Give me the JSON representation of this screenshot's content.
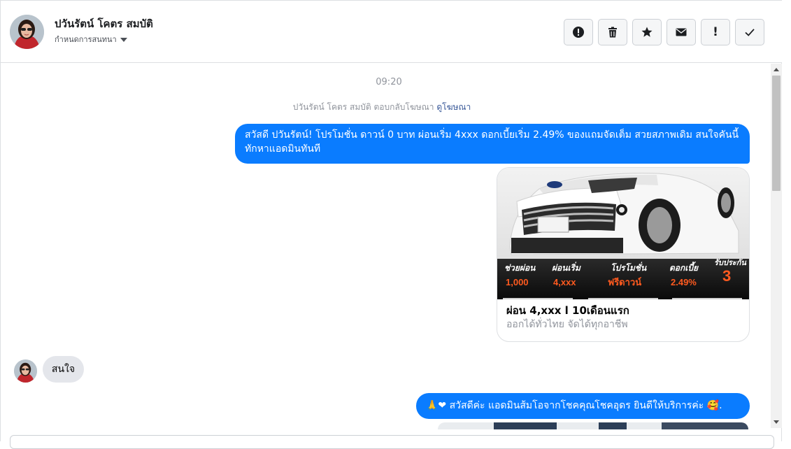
{
  "contact": {
    "name": "ปวันรัตน์ โคตร สมบัติ",
    "assign_label": "กำหนดการสนทนา"
  },
  "toolbar": {
    "buttons": [
      {
        "icon": "alert-circle-icon",
        "label": ""
      },
      {
        "icon": "trash-icon",
        "label": ""
      },
      {
        "icon": "star-icon",
        "label": ""
      },
      {
        "icon": "envelope-icon",
        "label": ""
      },
      {
        "icon": "exclamation-icon",
        "label": "!"
      },
      {
        "icon": "check-icon",
        "label": ""
      }
    ]
  },
  "thread": {
    "timestamp": "09:20",
    "ad_reply_text": "ปวันรัตน์ โคตร สมบัติ ตอบกลับโฆษณา",
    "ad_reply_link": "ดูโฆษณา",
    "messages": [
      {
        "direction": "outgoing",
        "text": "สวัสดี ปวันรัตน์! โปรโมชั่น ดาวน์ 0 บาท ผ่อนเริ่ม 4xxx ดอกเบี้ยเริ่ม 2.49% ของแถมจัดเต็ม สวยสภาพเดิม สนใจคันนี้ทักหาแอดมินทันที"
      },
      {
        "direction": "outgoing",
        "type": "card",
        "title": "ผ่อน 4,xxx l 10เดือนแรก",
        "subtitle": "ออกได้ทั่วไทย จัดได้ทุกอาชีพ",
        "banner": [
          {
            "label": "ช่วยผ่อน",
            "value": "1,000"
          },
          {
            "label": "ผ่อนเริ่ม",
            "value": "4,xxx"
          },
          {
            "label": "โปรโมชั่น",
            "value": "ฟรีดาวน์"
          },
          {
            "label": "ดอกเบี้ย",
            "value": "2.49%"
          },
          {
            "label": "รับประกัน",
            "value": "3"
          }
        ]
      },
      {
        "direction": "incoming",
        "text": "สนใจ"
      },
      {
        "direction": "outgoing",
        "text": "สวัสดีค่ะ แอดมินส้มโอจากโชคคุณโชคอุดร ยินดีให้บริการค่ะ",
        "prefix_emoji": "🙏❤",
        "suffix_emoji": "🥰."
      }
    ]
  },
  "colors": {
    "outgoing_bubble": "#0a7cff",
    "incoming_bubble": "#e4e6eb",
    "link": "#385898",
    "muted": "#90949c"
  }
}
